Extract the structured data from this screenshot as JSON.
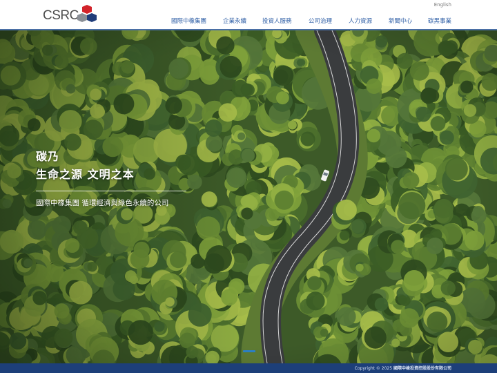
{
  "header": {
    "logo_text": "CSRC",
    "language_link": "English",
    "nav": [
      {
        "label": "國際中橡集團"
      },
      {
        "label": "企業永續"
      },
      {
        "label": "投資人服務"
      },
      {
        "label": "公司治理"
      },
      {
        "label": "人力資源"
      },
      {
        "label": "新聞中心"
      },
      {
        "label": "碳黑事業"
      }
    ]
  },
  "hero": {
    "line1": "碳乃",
    "line2": "生命之源 文明之本",
    "tagline": "國際中橡集團 循環經濟與綠色永續的公司",
    "slide_indicator_active": 1
  },
  "footer": {
    "copyright_prefix": "Copyright © 2025",
    "company": "國際中橡投資控股股份有限公司"
  },
  "colors": {
    "brand_blue": "#2f5fa6",
    "footer_blue": "#1d3f79",
    "logo_red": "#d2232a",
    "logo_navy": "#1f3c7a",
    "logo_gray": "#8a8f96"
  }
}
